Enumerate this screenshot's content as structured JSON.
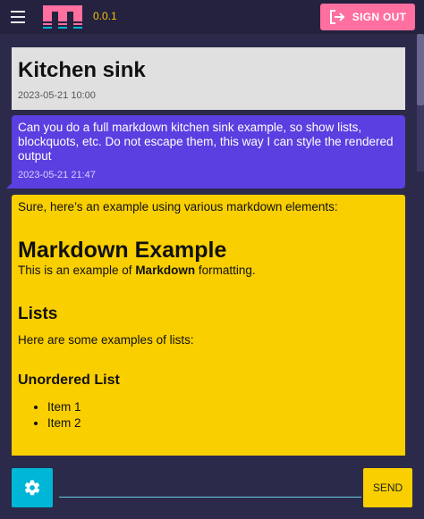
{
  "header": {
    "version": "0.0.1",
    "signout_label": "SIGN OUT",
    "colors": {
      "accent": "#ff6f9f",
      "version": "#f5c400"
    }
  },
  "messages": {
    "title_card": {
      "title": "Kitchen sink",
      "timestamp": "2023-05-21 10:00"
    },
    "user": {
      "text": "Can you do a full markdown kitchen sink example, so show lists, blockquots, etc. Do not escape them, this way I can style the rendered output",
      "timestamp": "2023-05-21 21:47"
    },
    "assistant": {
      "intro": "Sure, here’s an example using various markdown elements:",
      "h1": "Markdown Example",
      "p1_before": "This is an example of ",
      "p1_bold": "Markdown",
      "p1_after": " formatting.",
      "h2": "Lists",
      "p2": "Here are some examples of lists:",
      "h3": "Unordered List",
      "list": [
        "Item 1",
        "Item 2"
      ]
    }
  },
  "composer": {
    "input_value": "",
    "input_placeholder": "",
    "send_label": "SEND"
  },
  "icons": {
    "menu": "hamburger-icon",
    "signout": "logout-icon",
    "settings": "gear-icon"
  }
}
